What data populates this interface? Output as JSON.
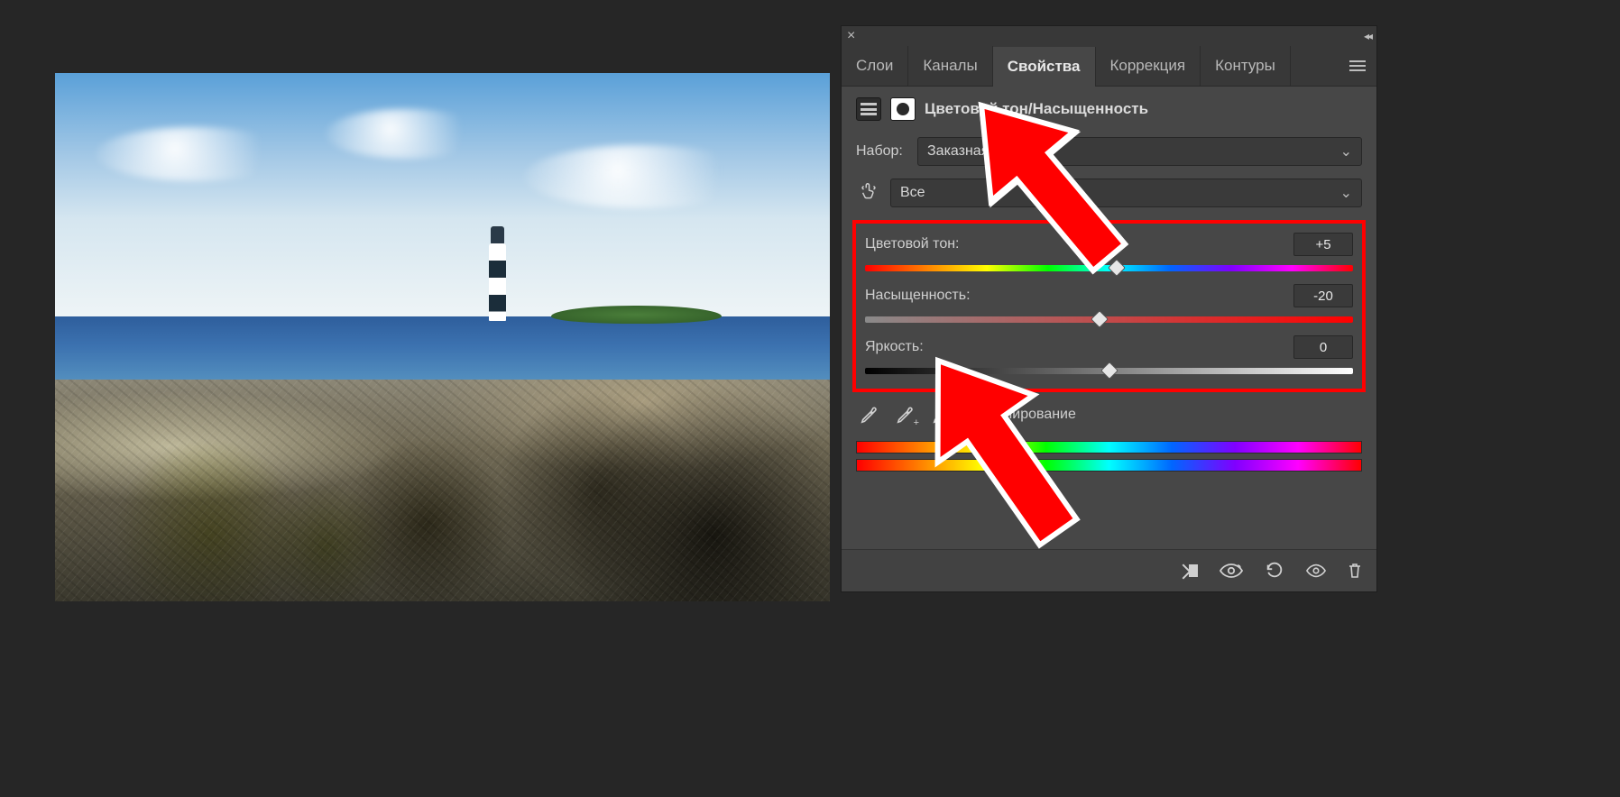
{
  "tabs": {
    "layers": "Слои",
    "channels": "Каналы",
    "properties": "Свойства",
    "adjustments": "Коррекция",
    "paths": "Контуры"
  },
  "adjustment_title": "Цветовой тон/Насыщенность",
  "preset": {
    "label": "Набор:",
    "value": "Заказная"
  },
  "edit": {
    "value": "Все"
  },
  "sliders": {
    "hue": {
      "label": "Цветовой тон:",
      "value": "+5",
      "pos": 51.5
    },
    "saturation": {
      "label": "Насыщенность:",
      "value": "-20",
      "pos": 48
    },
    "lightness": {
      "label": "Яркость:",
      "value": "0",
      "pos": 50
    }
  },
  "colorize_label": "Тонирование",
  "arrow_targets": {
    "top": "hue slider thumb",
    "bottom": "saturation slider thumb"
  }
}
